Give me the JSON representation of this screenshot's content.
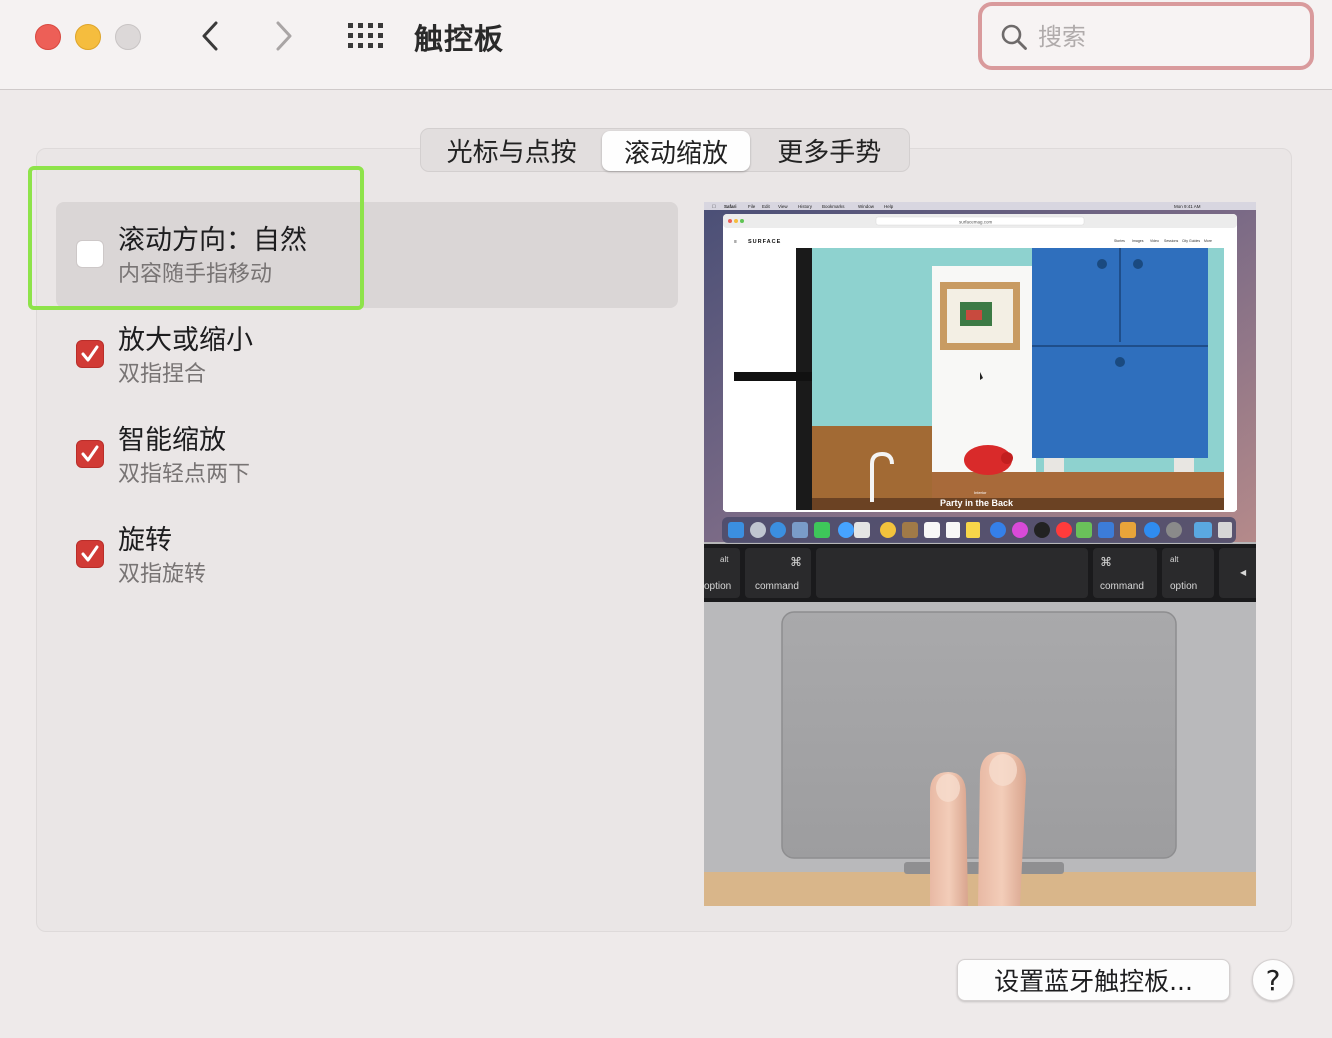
{
  "window": {
    "title": "触控板"
  },
  "search": {
    "placeholder": "搜索",
    "value": ""
  },
  "tabs": [
    {
      "label": "光标与点按",
      "selected": false
    },
    {
      "label": "滚动缩放",
      "selected": true
    },
    {
      "label": "更多手势",
      "selected": false
    }
  ],
  "options": [
    {
      "title": "滚动方向：自然",
      "subtitle": "内容随手指移动",
      "checked": false
    },
    {
      "title": "放大或缩小",
      "subtitle": "双指捏合",
      "checked": true
    },
    {
      "title": "智能缩放",
      "subtitle": "双指轻点两下",
      "checked": true
    },
    {
      "title": "旋转",
      "subtitle": "双指旋转",
      "checked": true
    }
  ],
  "preview": {
    "menubar_items": [
      "Safari",
      "File",
      "Edit",
      "View",
      "History",
      "Bookmarks",
      "Window",
      "Help"
    ],
    "menubar_clock": "Mon 9:41 AM",
    "url": "surfacemag.com",
    "site_logo": "SURFACE",
    "site_nav": [
      "Stories",
      "Images",
      "Video",
      "Sessions",
      "City Guides",
      "More"
    ],
    "caption_kicker": "Interior",
    "caption": "Party in the Back",
    "keys": {
      "left_alt": "alt",
      "left_option": "option",
      "left_cmd_symbol": "⌘",
      "left_command": "command",
      "right_cmd_symbol": "⌘",
      "right_command": "command",
      "right_alt": "alt",
      "right_option": "option",
      "arrow": "◀"
    }
  },
  "footer": {
    "bluetooth_button": "设置蓝牙触控板...",
    "help_button": "?"
  },
  "colors": {
    "checkbox_on": "#d13a35",
    "annotation_frame": "#8ee34a",
    "search_focus": "#d99a9c"
  }
}
